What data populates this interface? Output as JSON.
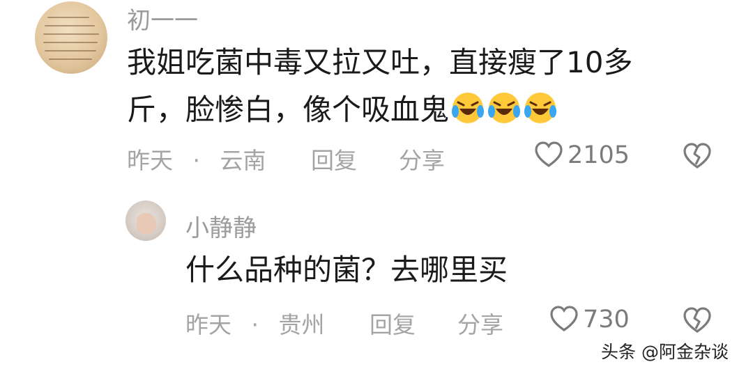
{
  "comment1": {
    "username": "初一一",
    "text_line1": "我姐吃菌中毒又拉又吐，直接瘦了10多",
    "text_line2": "斤，脸惨白，像个吸血鬼",
    "emoji_name": "laugh-cry-icon",
    "emoji_count": 3,
    "time": "昨天",
    "dot": "·",
    "location": "云南",
    "reply_label": "回复",
    "share_label": "分享",
    "like_count": "2105"
  },
  "comment2": {
    "username": "小静静",
    "text": "什么品种的菌？去哪里买",
    "time": "昨天",
    "dot": "·",
    "location": "贵州",
    "reply_label": "回复",
    "share_label": "分享",
    "like_count": "730"
  },
  "watermark": "头条 @阿金杂谈",
  "colors": {
    "primary_text": "#1a1a1a",
    "secondary_text": "#9a9a9a",
    "emoji_yellow": "#ffc93a",
    "emoji_tear": "#3aa6f0"
  }
}
